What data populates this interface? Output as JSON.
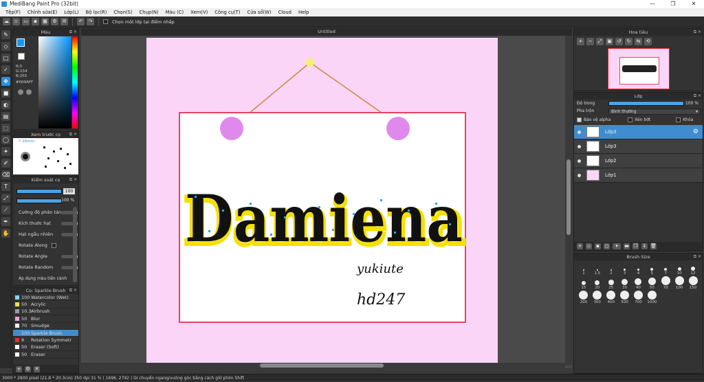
{
  "app": {
    "title": "MediBang Paint Pro (32bit)"
  },
  "window_controls": [
    "—",
    "❐",
    "✕"
  ],
  "menu": [
    "Tệp(F)",
    "Chỉnh sửa(E)",
    "Lớp(L)",
    "Bộ lọc(R)",
    "Chọn(S)",
    "Chụp(N)",
    "Màu (C)",
    "Xem(V)",
    "Công cụ(T)",
    "Cửa sổ(W)",
    "Cloud",
    "Help"
  ],
  "toolbar": {
    "checkbox_label": "Chọn một lớp tại điểm nhấp"
  },
  "document": {
    "tab": "Untitled"
  },
  "color_panel": {
    "title": "Màu",
    "r": "R:0",
    "g": "G:154",
    "b": "B:255",
    "hex": "#009AFF"
  },
  "brush_preview": {
    "title": "Xem trước cọ",
    "size": "7.26mm"
  },
  "brush_control": {
    "title": "Kiểm soát cọ",
    "size_value": "100",
    "opacity_value": "100 %",
    "items": [
      "Cường độ phân tán",
      "Kích thước hạt",
      "Hạt ngẫu nhiên",
      "Rotate Along",
      "Rotate Angle",
      "Rotate Random",
      "Áp dụng màu tiền cảnh"
    ]
  },
  "brush_list": {
    "title": "Cọ: Sparkle Brush",
    "items": [
      {
        "size": "100",
        "name": "Watercolor (Wet)",
        "color": "#7fd7f0"
      },
      {
        "size": "50",
        "name": "Acrylic",
        "color": "#f0e040"
      },
      {
        "size": "10.3",
        "name": "Airbrush",
        "color": "#999999"
      },
      {
        "size": "50",
        "name": "Blur",
        "color": "#f0a0e0"
      },
      {
        "size": "70",
        "name": "Smudge",
        "color": "#f0f0f0"
      },
      {
        "size": "100",
        "name": "Sparkle Brush",
        "color": "#3f8dd0"
      },
      {
        "size": "8",
        "name": "Rotation Symmetr",
        "color": "#e03030"
      },
      {
        "size": "50",
        "name": "Eraser (Soft)",
        "color": "#ffffff"
      },
      {
        "size": "50",
        "name": "Eraser",
        "color": "#ffffff"
      }
    ],
    "selected_index": 5
  },
  "canvas_text": {
    "title": "Damiena",
    "sig1": "yukiute",
    "sig2": "hd247"
  },
  "navigator": {
    "title": "Hoa tiêu"
  },
  "layers": {
    "title": "Lớp",
    "opacity_label": "Độ trong",
    "opacity_value": "100 %",
    "blend_label": "Pha trộn",
    "blend_value": "Bình thường",
    "alpha_label": "Bảo vệ alpha",
    "clip_label": "Xén bớt",
    "lock_label": "Khóa",
    "items": [
      {
        "name": "Lớp3",
        "selected": true
      },
      {
        "name": "Lớp3",
        "selected": false
      },
      {
        "name": "Lớp2",
        "selected": false
      },
      {
        "name": "Lớp1",
        "selected": false
      }
    ]
  },
  "brush_size": {
    "title": "Brush Size",
    "sizes": [
      "1",
      "1.5",
      "2",
      "3",
      "4",
      "5",
      "7",
      "10",
      "12",
      "15",
      "20",
      "25",
      "30",
      "40",
      "50",
      "70",
      "100",
      "150",
      "200",
      "300",
      "400",
      "500",
      "700",
      "1000"
    ]
  },
  "status": {
    "text": "3000 * 2800 pixel   (21.8 * 20.3cm)   350 dpi   31 %   ( 1696, 2792 )   Di chuyển ngang/vuông góc bằng cách giữ phím Shift"
  }
}
